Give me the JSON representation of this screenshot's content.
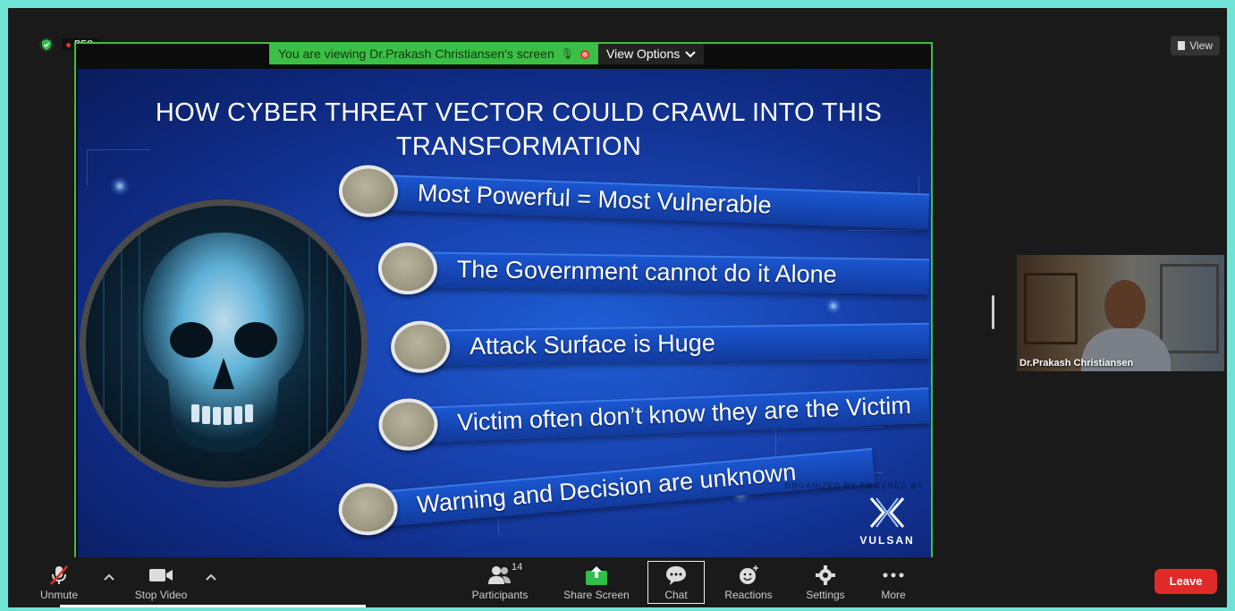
{
  "top_bar": {
    "rec_label": "REC",
    "view_label": "View"
  },
  "share_banner": {
    "viewing_text": "You are viewing Dr.Prakash Christiansen's screen",
    "view_options_label": "View Options"
  },
  "slide": {
    "title_line1": "HOW CYBER THREAT VECTOR COULD CRAWL INTO THIS",
    "title_line2": "TRANSFORMATION",
    "items": [
      "Most Powerful = Most Vulnerable",
      "The Government cannot do it Alone",
      "Attack Surface is Huge",
      "Victim often don’t know they are the Victim",
      "Warning and Decision are unknown"
    ],
    "logo_text": "VULSAN",
    "small_logos_text": "ORGANIZED BY    POWERED BY"
  },
  "participant": {
    "name": "Dr.Prakash Christiansen"
  },
  "toolbar": {
    "unmute": "Unmute",
    "stop_video": "Stop Video",
    "participants": "Participants",
    "participants_count": "14",
    "share_screen": "Share Screen",
    "chat": "Chat",
    "reactions": "Reactions",
    "settings": "Settings",
    "more": "More",
    "leave": "Leave"
  },
  "colors": {
    "share_border": "#3fbf3a",
    "banner_green": "#3cbf47",
    "leave_red": "#e02a2a",
    "slide_blue": "#1843b0",
    "frame_teal": "#6fe3d6"
  },
  "icons": [
    "shield-icon",
    "rec-dot-icon",
    "view-icon",
    "mic-muted-icon",
    "video-camera-icon",
    "participants-icon",
    "share-screen-icon",
    "chat-icon",
    "reactions-icon",
    "settings-icon",
    "more-icon",
    "chevron-down-icon",
    "chevron-up-icon"
  ]
}
